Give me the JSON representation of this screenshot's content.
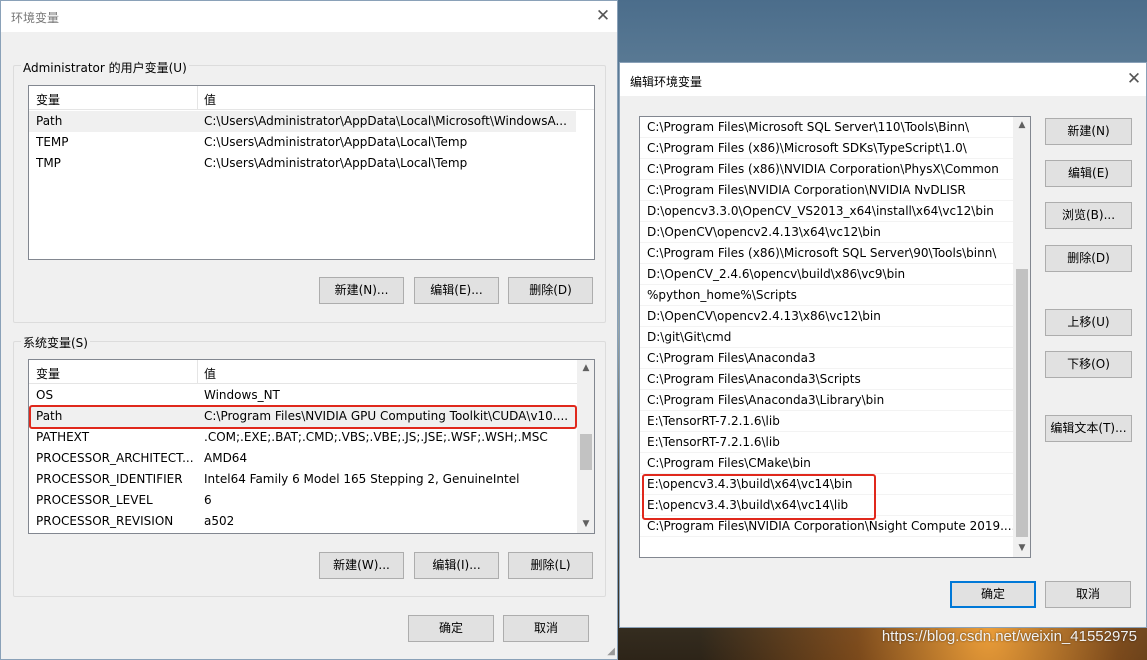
{
  "watermark": "https://blog.csdn.net/weixin_41552975",
  "env_dialog": {
    "title": "环境变量",
    "close_glyph": "✕",
    "user_group_label": "Administrator 的用户变量(U)",
    "columns": [
      "变量",
      "值"
    ],
    "user_vars": [
      {
        "name": "Path",
        "value": "C:\\Users\\Administrator\\AppData\\Local\\Microsoft\\WindowsA..."
      },
      {
        "name": "TEMP",
        "value": "C:\\Users\\Administrator\\AppData\\Local\\Temp"
      },
      {
        "name": "TMP",
        "value": "C:\\Users\\Administrator\\AppData\\Local\\Temp"
      }
    ],
    "user_buttons": {
      "new": "新建(N)...",
      "edit": "编辑(E)...",
      "delete": "删除(D)"
    },
    "system_group_label": "系统变量(S)",
    "system_vars": [
      {
        "name": "OS",
        "value": "Windows_NT"
      },
      {
        "name": "Path",
        "value": "C:\\Program Files\\NVIDIA GPU Computing Toolkit\\CUDA\\v10...."
      },
      {
        "name": "PATHEXT",
        "value": ".COM;.EXE;.BAT;.CMD;.VBS;.VBE;.JS;.JSE;.WSF;.WSH;.MSC"
      },
      {
        "name": "PROCESSOR_ARCHITECT...",
        "value": "AMD64"
      },
      {
        "name": "PROCESSOR_IDENTIFIER",
        "value": "Intel64 Family 6 Model 165 Stepping 2, GenuineIntel"
      },
      {
        "name": "PROCESSOR_LEVEL",
        "value": "6"
      },
      {
        "name": "PROCESSOR_REVISION",
        "value": "a502"
      }
    ],
    "system_buttons": {
      "new": "新建(W)...",
      "edit": "编辑(I)...",
      "delete": "删除(L)"
    },
    "ok": "确定",
    "cancel": "取消",
    "scroll_up": "▲",
    "scroll_down": "▼"
  },
  "edit_dialog": {
    "title": "编辑环境变量",
    "close_glyph": "✕",
    "paths": [
      "C:\\Program Files\\Microsoft SQL Server\\110\\Tools\\Binn\\",
      "C:\\Program Files (x86)\\Microsoft SDKs\\TypeScript\\1.0\\",
      "C:\\Program Files (x86)\\NVIDIA Corporation\\PhysX\\Common",
      "C:\\Program Files\\NVIDIA Corporation\\NVIDIA NvDLISR",
      "D:\\opencv3.3.0\\OpenCV_VS2013_x64\\install\\x64\\vc12\\bin",
      "D:\\OpenCV\\opencv2.4.13\\x64\\vc12\\bin",
      "C:\\Program Files (x86)\\Microsoft SQL Server\\90\\Tools\\binn\\",
      "D:\\OpenCV_2.4.6\\opencv\\build\\x86\\vc9\\bin",
      "%python_home%\\Scripts",
      "D:\\OpenCV\\opencv2.4.13\\x86\\vc12\\bin",
      "D:\\git\\Git\\cmd",
      "C:\\Program Files\\Anaconda3",
      "C:\\Program Files\\Anaconda3\\Scripts",
      "C:\\Program Files\\Anaconda3\\Library\\bin",
      "E:\\TensorRT-7.2.1.6\\lib",
      "E:\\TensorRT-7.2.1.6\\lib",
      "C:\\Program Files\\CMake\\bin",
      "E:\\opencv3.4.3\\build\\x64\\vc14\\bin",
      "E:\\opencv3.4.3\\build\\x64\\vc14\\lib",
      "C:\\Program Files\\NVIDIA Corporation\\Nsight Compute 2019...."
    ],
    "buttons": {
      "new": "新建(N)",
      "edit": "编辑(E)",
      "browse": "浏览(B)...",
      "delete": "删除(D)",
      "move_up": "上移(U)",
      "move_down": "下移(O)",
      "edit_text": "编辑文本(T)..."
    },
    "ok": "确定",
    "cancel": "取消",
    "scroll_up": "▲",
    "scroll_down": "▼"
  },
  "colors": {
    "highlight": "#e0281c",
    "focus": "#0078d7"
  }
}
